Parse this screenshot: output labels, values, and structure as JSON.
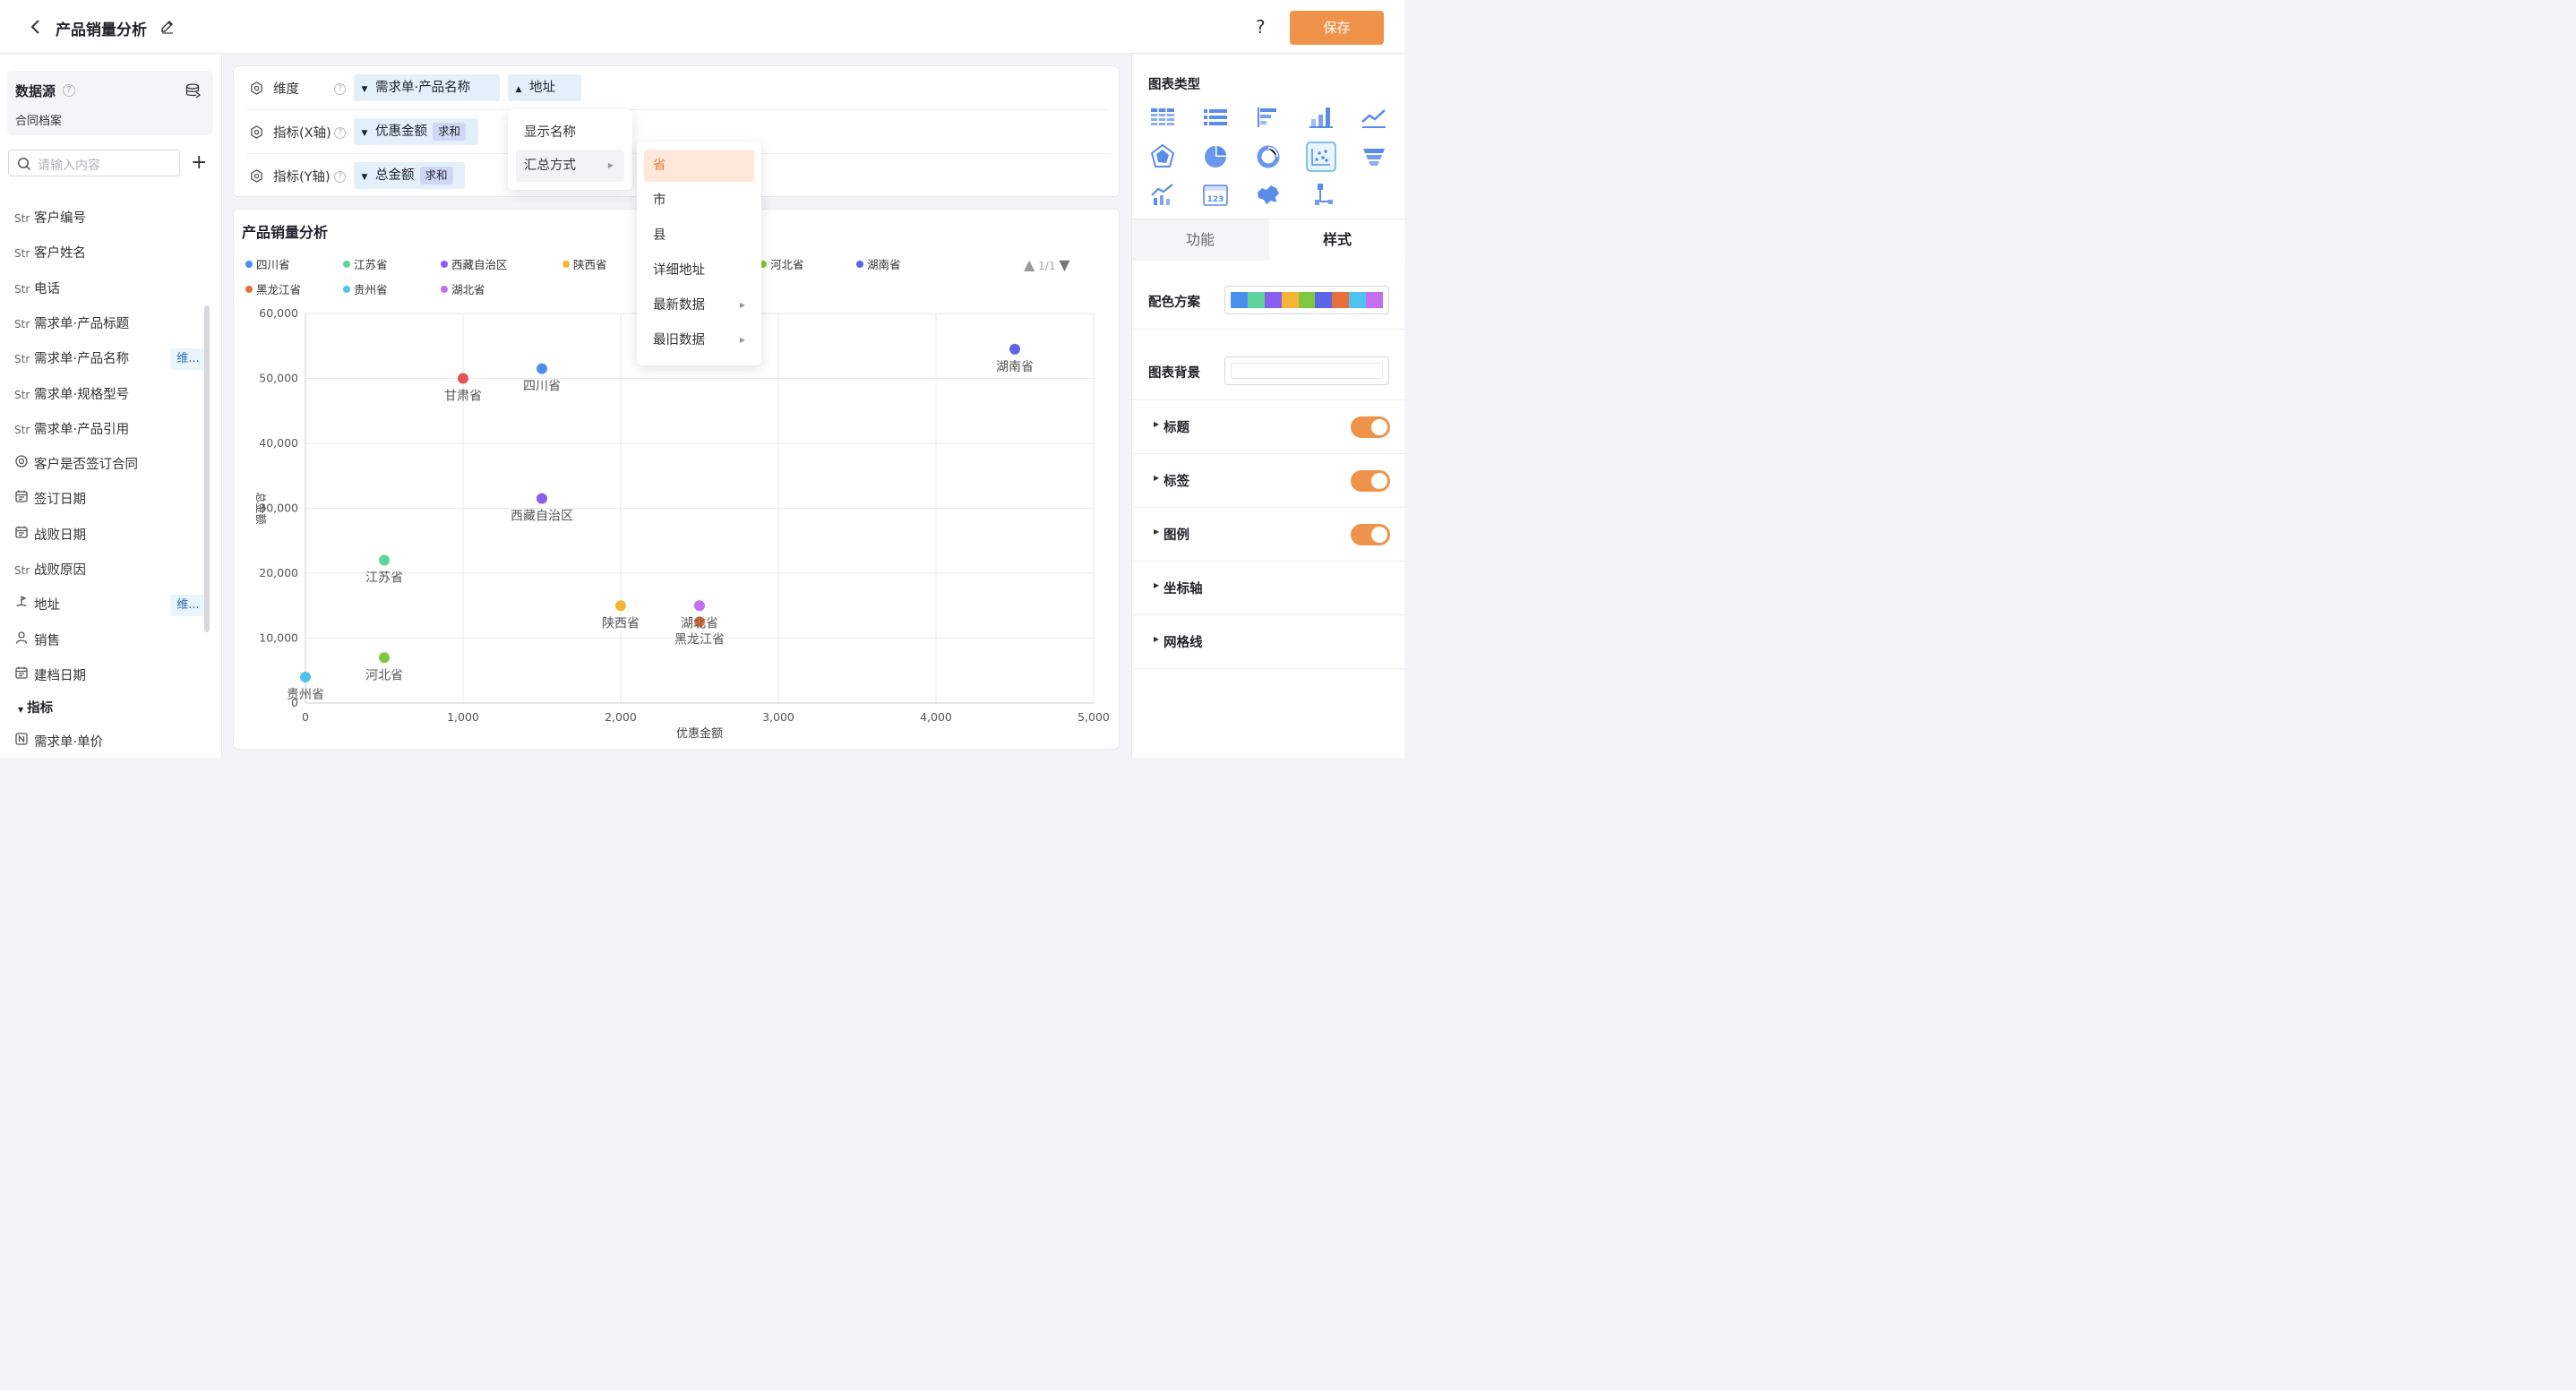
{
  "header": {
    "title": "产品销量分析",
    "help_label": "?",
    "save_label": "保存"
  },
  "left_panel": {
    "datasource_title": "数据源",
    "datasource_name": "合同档案",
    "search_placeholder": "请输入内容",
    "fields": [
      {
        "type": "Str",
        "name": "客户编号"
      },
      {
        "type": "Str",
        "name": "客户姓名"
      },
      {
        "type": "Str",
        "name": "电话"
      },
      {
        "type": "Str",
        "name": "需求单·产品标题"
      },
      {
        "type": "Str",
        "name": "需求单·产品名称",
        "badge": "维..."
      },
      {
        "type": "Str",
        "name": "需求单·规格型号"
      },
      {
        "type": "Str",
        "name": "需求单·产品引用"
      },
      {
        "type": "radio-icon",
        "name": "客户是否签订合同"
      },
      {
        "type": "calendar-icon",
        "name": "签订日期"
      },
      {
        "type": "calendar-icon",
        "name": "战败日期"
      },
      {
        "type": "Str",
        "name": "战败原因"
      },
      {
        "type": "location-icon",
        "name": "地址",
        "badge": "维..."
      },
      {
        "type": "user-icon",
        "name": "销售"
      },
      {
        "type": "calendar-icon",
        "name": "建档日期"
      }
    ],
    "metrics_group": "指标",
    "metric_fields": [
      {
        "type": "number-icon",
        "name": "需求单·单价"
      }
    ]
  },
  "config": {
    "dimension_label": "维度",
    "dimension_chips": [
      "需求单·产品名称",
      "地址"
    ],
    "x_label": "指标(X轴)",
    "x_chip": "优惠金额",
    "x_agg": "求和",
    "y_label": "指标(Y轴)",
    "y_chip": "总金额",
    "y_agg": "求和"
  },
  "dropdown": {
    "items": [
      "显示名称",
      "汇总方式"
    ],
    "submenu": [
      "省",
      "市",
      "县",
      "详细地址",
      "最新数据",
      "最旧数据"
    ],
    "submenu_selected": "省",
    "selected_color": "#fde8d9",
    "selected_text_color": "#e8803a"
  },
  "chart_data": {
    "type": "scatter",
    "title": "产品销量分析",
    "xlabel": "优惠金额",
    "ylabel": "总金额",
    "xlim": [
      0,
      5000
    ],
    "ylim": [
      0,
      60000
    ],
    "xticks": [
      "0",
      "1,000",
      "2,000",
      "3,000",
      "4,000",
      "5,000"
    ],
    "yticks": [
      "0",
      "10,000",
      "20,000",
      "30,000",
      "40,000",
      "50,000",
      "60,000"
    ],
    "grid": true,
    "legend_position": "top",
    "legend_pager": "1/1",
    "series": [
      {
        "name": "四川省",
        "color": "#4a8ff0",
        "x": 1500,
        "y": 51500
      },
      {
        "name": "江苏省",
        "color": "#5ed49c",
        "x": 500,
        "y": 22000
      },
      {
        "name": "西藏自治区",
        "color": "#8a5ff0",
        "x": 1500,
        "y": 31500
      },
      {
        "name": "陕西省",
        "color": "#f5b436",
        "x": 2000,
        "y": 15000
      },
      {
        "name": "甘肃省",
        "color": "#e85454",
        "x": 1000,
        "y": 50000
      },
      {
        "name": "河北省",
        "color": "#7ec83e",
        "x": 500,
        "y": 7000
      },
      {
        "name": "湖南省",
        "color": "#5a66e8",
        "x": 4500,
        "y": 54500
      },
      {
        "name": "黑龙江省",
        "color": "#e8703a",
        "x": 2500,
        "y": 12500
      },
      {
        "name": "贵州省",
        "color": "#4ec3f0",
        "x": 0,
        "y": 4000
      },
      {
        "name": "湖北省",
        "color": "#c56ef0",
        "x": 2500,
        "y": 15000
      }
    ]
  },
  "right_panel": {
    "chart_type_title": "图表类型",
    "tabs": [
      "功能",
      "样式"
    ],
    "active_tab": "样式",
    "color_scheme_label": "配色方案",
    "color_scheme": [
      "#4a8ff0",
      "#5ed49c",
      "#8a5ff0",
      "#f5b436",
      "#7ec83e",
      "#5a66e8",
      "#e8703a",
      "#4ec3f0",
      "#c56ef0"
    ],
    "background_label": "图表背景",
    "sections": [
      {
        "label": "标题",
        "toggle": true
      },
      {
        "label": "标签",
        "toggle": true
      },
      {
        "label": "图例",
        "toggle": true
      },
      {
        "label": "坐标轴",
        "toggle": false
      },
      {
        "label": "网格线",
        "toggle": false
      }
    ],
    "accent_color": "#f0934a",
    "icon_color": "#5a8de8"
  }
}
